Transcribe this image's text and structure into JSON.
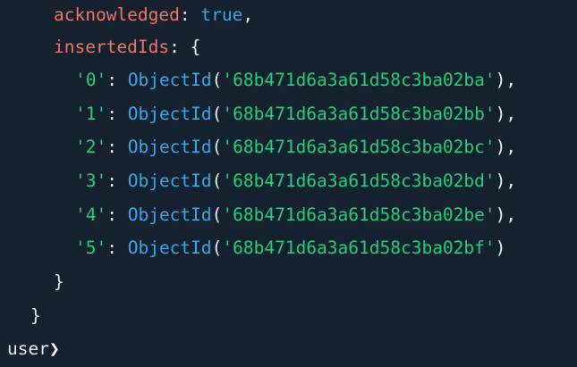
{
  "colors": {
    "background": "#162130",
    "key": "#f0755f",
    "keyword": "#35a8e8",
    "string": "#21d07a",
    "punctuation": "#e8ecef"
  },
  "output": {
    "acknowledged_key": "acknowledged",
    "acknowledged_value": "true",
    "inserted_ids_key": "insertedIds",
    "function_name": "ObjectId",
    "inserted_ids": [
      {
        "index": "'0'",
        "value": "'68b471d6a3a61d58c3ba02ba'"
      },
      {
        "index": "'1'",
        "value": "'68b471d6a3a61d58c3ba02bb'"
      },
      {
        "index": "'2'",
        "value": "'68b471d6a3a61d58c3ba02bc'"
      },
      {
        "index": "'3'",
        "value": "'68b471d6a3a61d58c3ba02bd'"
      },
      {
        "index": "'4'",
        "value": "'68b471d6a3a61d58c3ba02be'"
      },
      {
        "index": "'5'",
        "value": "'68b471d6a3a61d58c3ba02bf'"
      }
    ]
  },
  "prompt": {
    "text": "user",
    "symbol": "❯"
  }
}
